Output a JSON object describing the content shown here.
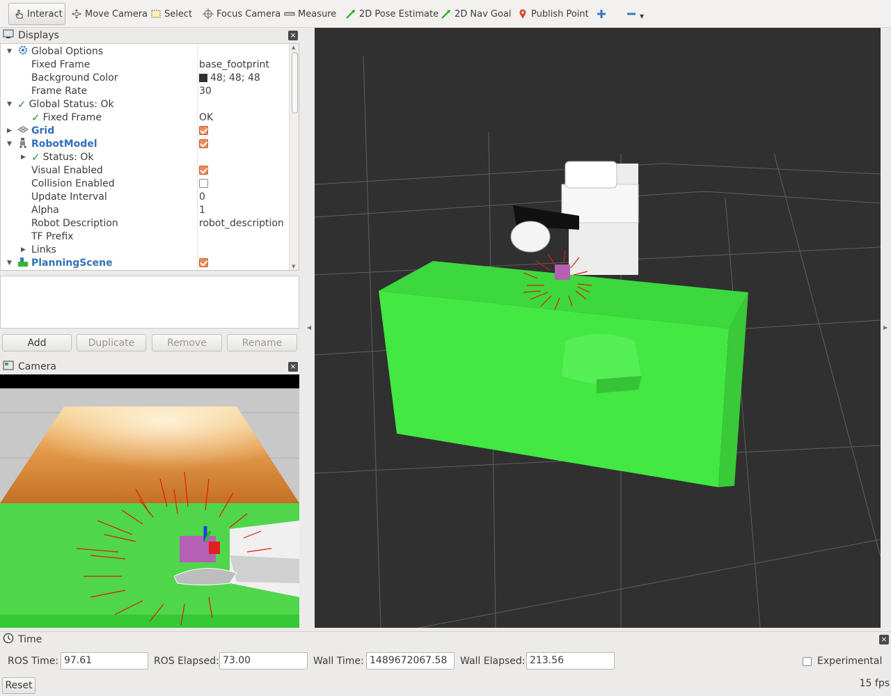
{
  "toolbar": {
    "tools": [
      {
        "label": "Interact",
        "icon": "hand-pointer-icon"
      },
      {
        "label": "Move Camera",
        "icon": "move-camera-icon"
      },
      {
        "label": "Select",
        "icon": "select-box-icon"
      },
      {
        "label": "Focus Camera",
        "icon": "focus-crosshair-icon"
      },
      {
        "label": "Measure",
        "icon": "ruler-icon"
      },
      {
        "label": "2D Pose Estimate",
        "icon": "green-arrow-icon"
      },
      {
        "label": "2D Nav Goal",
        "icon": "green-arrow-icon"
      },
      {
        "label": "Publish Point",
        "icon": "map-pin-icon"
      }
    ],
    "add_icon": "plus-icon",
    "remove_icon": "minus-icon"
  },
  "displays": {
    "title": "Displays",
    "tree": [
      {
        "name": "Global Options",
        "value": ""
      },
      {
        "name": "Fixed Frame",
        "value": "base_footprint"
      },
      {
        "name": "Background Color",
        "value": "48; 48; 48"
      },
      {
        "name": "Frame Rate",
        "value": "30"
      },
      {
        "name": "Global Status: Ok",
        "value": ""
      },
      {
        "name": "Fixed Frame",
        "value": "OK"
      },
      {
        "name": "Grid",
        "value": ""
      },
      {
        "name": "RobotModel",
        "value": ""
      },
      {
        "name": "Status: Ok",
        "value": ""
      },
      {
        "name": "Visual Enabled",
        "value": ""
      },
      {
        "name": "Collision Enabled",
        "value": ""
      },
      {
        "name": "Update Interval",
        "value": "0"
      },
      {
        "name": "Alpha",
        "value": "1"
      },
      {
        "name": "Robot Description",
        "value": "robot_description"
      },
      {
        "name": "TF Prefix",
        "value": ""
      },
      {
        "name": "Links",
        "value": ""
      },
      {
        "name": "PlanningScene",
        "value": ""
      }
    ],
    "buttons": {
      "add": "Add",
      "duplicate": "Duplicate",
      "remove": "Remove",
      "rename": "Rename"
    }
  },
  "camera": {
    "title": "Camera"
  },
  "time": {
    "title": "Time",
    "ros_time_label": "ROS Time:",
    "ros_time": "97.61",
    "ros_elapsed_label": "ROS Elapsed:",
    "ros_elapsed": "73.00",
    "wall_time_label": "Wall Time:",
    "wall_time": "1489672067.58",
    "wall_elapsed_label": "Wall Elapsed:",
    "wall_elapsed": "213.56",
    "experimental_label": "Experimental",
    "reset_label": "Reset",
    "fps": "15 fps"
  },
  "colors": {
    "viewport_bg": "#303030",
    "table_green": "#43e843",
    "arrow_red": "#e01a0a"
  }
}
